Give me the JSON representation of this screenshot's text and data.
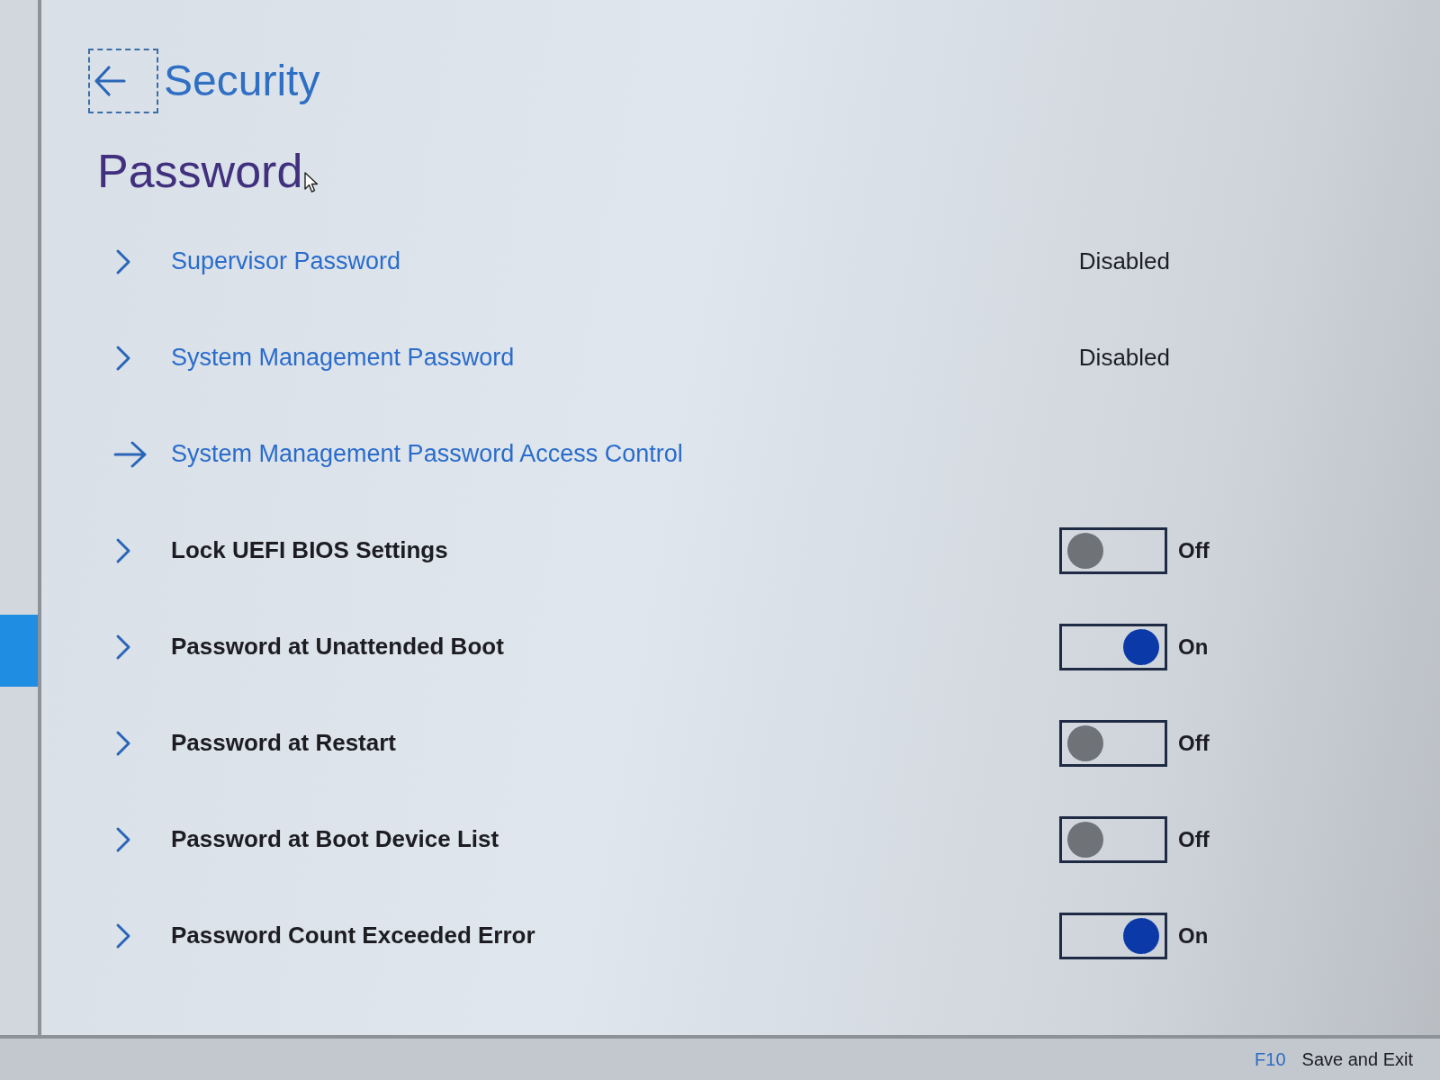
{
  "header": {
    "title": "Security"
  },
  "section_title": "Password",
  "items": [
    {
      "kind": "link",
      "label": "Supervisor Password",
      "value": "Disabled",
      "focused": false
    },
    {
      "kind": "link",
      "label": "System Management Password",
      "value": "Disabled",
      "focused": false
    },
    {
      "kind": "link",
      "label": "System Management Password Access Control",
      "focused": true
    },
    {
      "kind": "toggle",
      "label": "Lock UEFI BIOS Settings",
      "on": false,
      "state_label": "Off",
      "focused": false
    },
    {
      "kind": "toggle",
      "label": "Password at Unattended Boot",
      "on": true,
      "state_label": "On",
      "focused": false
    },
    {
      "kind": "toggle",
      "label": "Password at Restart",
      "on": false,
      "state_label": "Off",
      "focused": false
    },
    {
      "kind": "toggle",
      "label": "Password at Boot Device List",
      "on": false,
      "state_label": "Off",
      "focused": false
    },
    {
      "kind": "toggle",
      "label": "Password Count Exceeded Error",
      "on": true,
      "state_label": "On",
      "focused": false
    }
  ],
  "footer": {
    "keys": [
      {
        "key": "F10",
        "action": "Save and Exit"
      }
    ]
  }
}
